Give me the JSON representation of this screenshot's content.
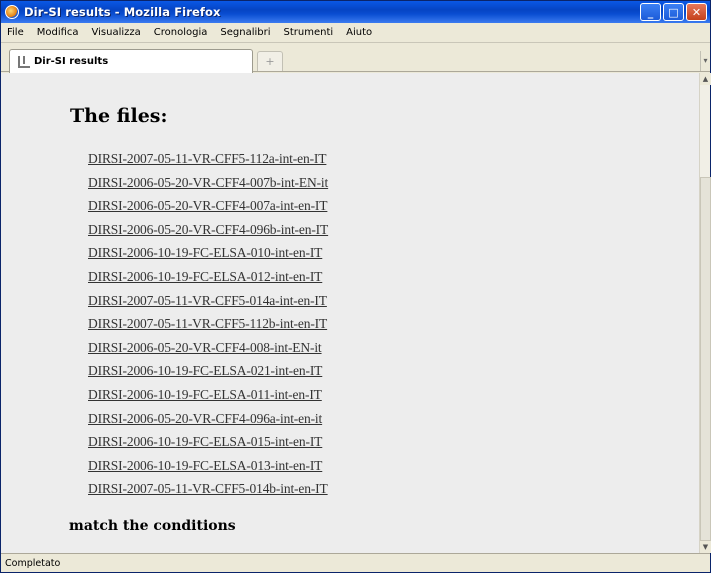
{
  "window": {
    "title": "Dir-SI results - Mozilla Firefox"
  },
  "menu": [
    "File",
    "Modifica",
    "Visualizza",
    "Cronologia",
    "Segnalibri",
    "Strumenti",
    "Aiuto"
  ],
  "tab": {
    "label": "Dir-SI results",
    "newtab": "+"
  },
  "page": {
    "heading": "The files:",
    "files": [
      "DIRSI-2007-05-11-VR-CFF5-112a-int-en-IT",
      "DIRSI-2006-05-20-VR-CFF4-007b-int-EN-it",
      "DIRSI-2006-05-20-VR-CFF4-007a-int-en-IT",
      "DIRSI-2006-05-20-VR-CFF4-096b-int-en-IT",
      "DIRSI-2006-10-19-FC-ELSA-010-int-en-IT",
      "DIRSI-2006-10-19-FC-ELSA-012-int-en-IT",
      "DIRSI-2007-05-11-VR-CFF5-014a-int-en-IT",
      "DIRSI-2007-05-11-VR-CFF5-112b-int-en-IT",
      "DIRSI-2006-05-20-VR-CFF4-008-int-EN-it",
      "DIRSI-2006-10-19-FC-ELSA-021-int-en-IT",
      "DIRSI-2006-10-19-FC-ELSA-011-int-en-IT",
      "DIRSI-2006-05-20-VR-CFF4-096a-int-en-it",
      "DIRSI-2006-10-19-FC-ELSA-015-int-en-IT",
      "DIRSI-2006-10-19-FC-ELSA-013-int-en-IT",
      "DIRSI-2007-05-11-VR-CFF5-014b-int-en-IT"
    ],
    "footer": "match the conditions"
  },
  "status": {
    "text": "Completato"
  },
  "icons": {
    "app": "firefox-icon",
    "tab": "page-icon",
    "minimize": "minimize-icon",
    "maximize": "maximize-icon",
    "close": "close-icon"
  },
  "colors": {
    "titlebar": "#0a4ed2",
    "content_bg": "#ededed",
    "link": "#333333"
  }
}
